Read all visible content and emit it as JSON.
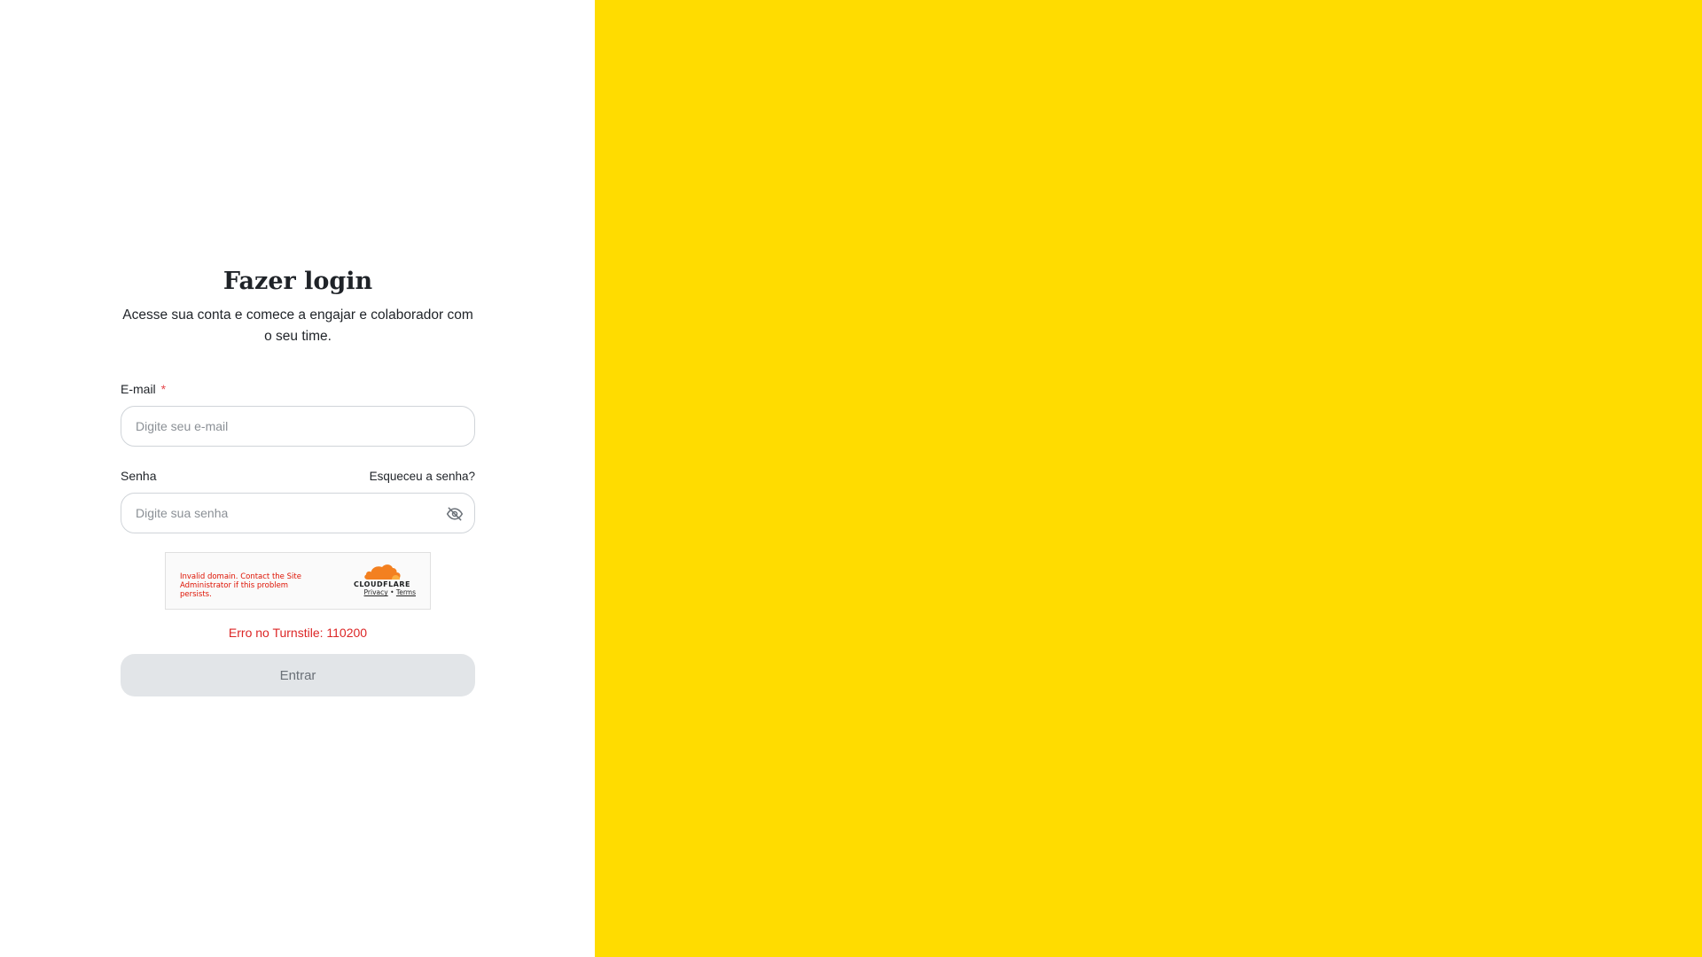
{
  "login": {
    "title": "Fazer login",
    "subtitle": "Acesse sua conta e comece a engajar e colaborador com o seu time.",
    "email_label": "E-mail",
    "required_mark": "*",
    "email_placeholder": "Digite seu e-mail",
    "password_label": "Senha",
    "forgot_password": "Esqueceu a senha?",
    "password_placeholder": "Digite sua senha",
    "password_toggle_icon": "eye-off-icon",
    "submit_label": "Entrar",
    "turnstile_status": "Erro no Turnstile: 110200"
  },
  "turnstile_widget": {
    "error_message": "Invalid domain. Contact the Site Administrator if this problem persists.",
    "brand": "CLOUDFLARE",
    "privacy_link": "Privacy",
    "separator": "•",
    "terms_link": "Terms"
  },
  "colors": {
    "brand_panel": "#FFDC00",
    "error": "#dc2626",
    "required": "#e5484d",
    "button_disabled_bg": "#e2e5e8",
    "cloudflare_orange": "#F38020"
  }
}
